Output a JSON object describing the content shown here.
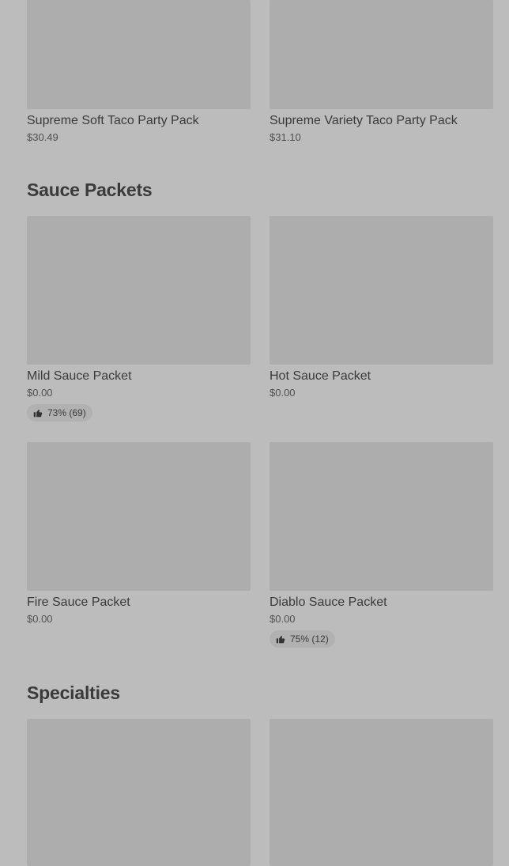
{
  "party_packs": {
    "items": [
      {
        "name": "Supreme Soft Taco Party Pack",
        "price": "$30.49"
      },
      {
        "name": "Supreme Variety Taco Party Pack",
        "price": "$31.10"
      }
    ]
  },
  "sauce_packets": {
    "title": "Sauce Packets",
    "items": [
      {
        "name": "Mild Sauce Packet",
        "price": "$0.00",
        "rating": "73% (69)"
      },
      {
        "name": "Hot Sauce Packet",
        "price": "$0.00"
      },
      {
        "name": "Fire Sauce Packet",
        "price": "$0.00"
      },
      {
        "name": "Diablo Sauce Packet",
        "price": "$0.00",
        "rating": "75% (12)"
      }
    ]
  },
  "specialties": {
    "title": "Specialties"
  },
  "icons": {
    "rating": "thumbs-up-icon"
  },
  "colors": {
    "background": "#bcbcbc",
    "image_placeholder": "#adadad",
    "rating_pill": "#b1b1b1"
  }
}
